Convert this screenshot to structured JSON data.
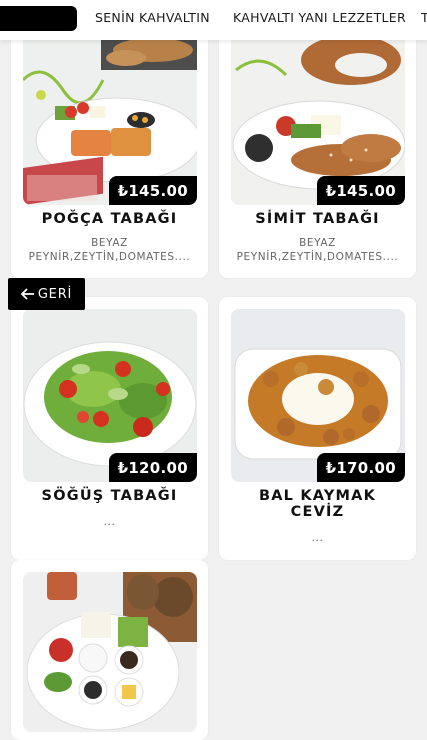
{
  "nav": {
    "tabs": [
      "SENİN KAHVALTIN",
      "KAHVALTI YANI LEZZETLER",
      "T"
    ]
  },
  "back_button": {
    "label": "GERİ",
    "icon": "arrow-left-icon"
  },
  "products": [
    {
      "title": "POĞÇA TABAĞI",
      "price": "₺145.00",
      "desc": "BEYAZ",
      "desc2": "PEYNİR,ZEYTİN,DOMATES...."
    },
    {
      "title": "SİMİT TABAĞI",
      "price": "₺145.00",
      "desc": "BEYAZ",
      "desc2": "PEYNİR,ZEYTİN,DOMATES...."
    },
    {
      "title": "SÖĞÜŞ TABAĞI",
      "price": "₺120.00",
      "desc": "..."
    },
    {
      "title": "BAL KAYMAK",
      "title2": "CEVİZ",
      "price": "₺170.00",
      "desc": "..."
    },
    {
      "title": "",
      "price": "",
      "desc": ""
    }
  ]
}
